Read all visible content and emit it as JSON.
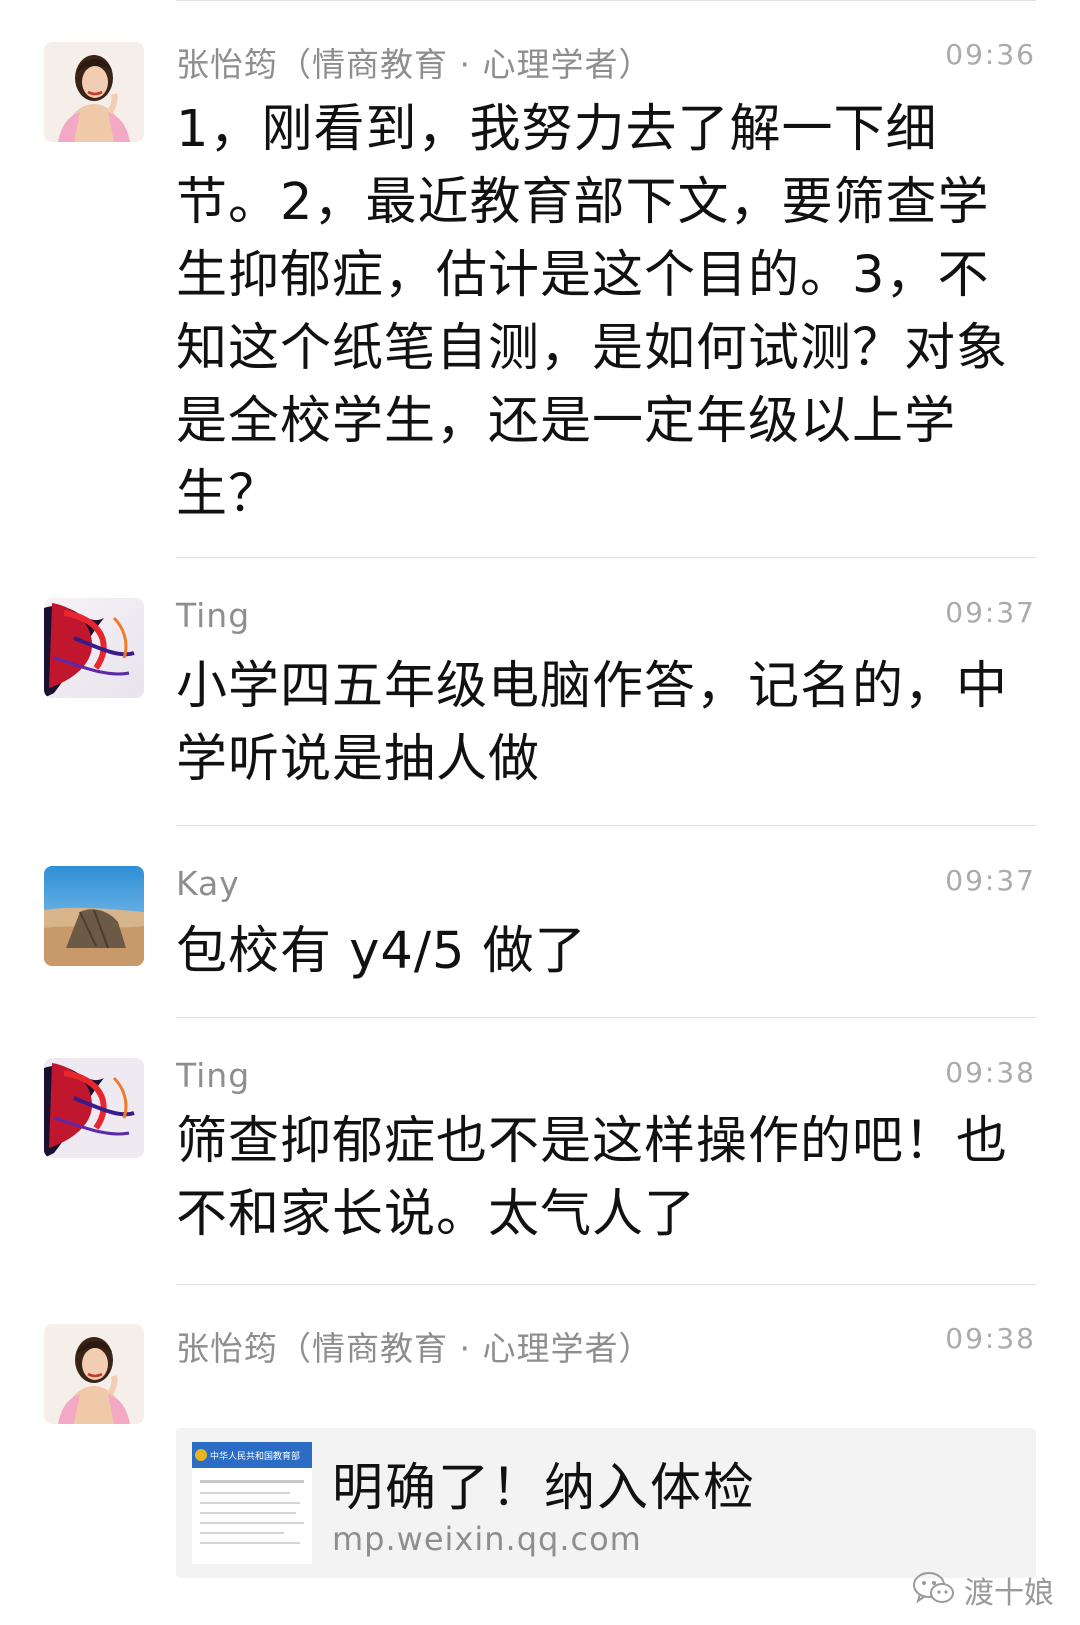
{
  "messages": [
    {
      "sender": "张怡筠（情商教育 · 心理学者）",
      "time": "09:36",
      "text": "1，刚看到，我努力去了解一下细节。2，最近教育部下文，要筛查学生抑郁症，估计是这个目的。3，不知这个纸笔自测，是如何试测？对象是全校学生，还是一定年级以上学生？"
    },
    {
      "sender": "Ting",
      "time": "09:37",
      "text": "小学四五年级电脑作答，记名的，中学听说是抽人做"
    },
    {
      "sender": "Kay",
      "time": "09:37",
      "text": "包校有 y4/5 做了"
    },
    {
      "sender": "Ting",
      "time": "09:38",
      "text": "筛查抑郁症也不是这样操作的吧！也不和家长说。太气人了"
    },
    {
      "sender": "张怡筠（情商教育 · 心理学者）",
      "time": "09:38",
      "link": {
        "thumb_header": "中华人民共和国教育部",
        "title": "明确了！纳入体检",
        "domain": "mp.weixin.qq.com"
      }
    }
  ],
  "watermark": {
    "text": "渡十娘",
    "icon": "wechat-icon"
  },
  "colors": {
    "text": "#111111",
    "meta": "#8e8e8e",
    "time": "#ababab",
    "divider": "#e2e2e2",
    "card": "#f3f3f3"
  }
}
